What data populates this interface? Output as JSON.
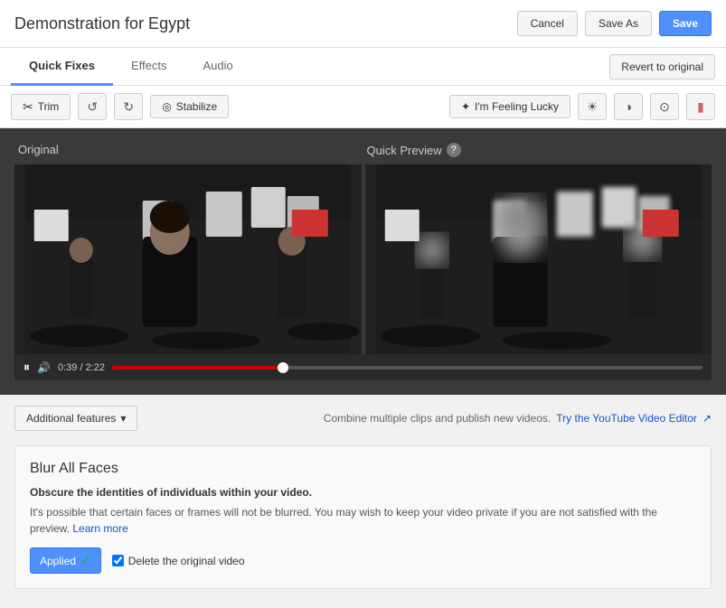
{
  "header": {
    "title": "Demonstration for Egypt",
    "cancel_label": "Cancel",
    "save_as_label": "Save As",
    "save_label": "Save"
  },
  "tabs": {
    "quick_fixes_label": "Quick Fixes",
    "effects_label": "Effects",
    "audio_label": "Audio",
    "revert_label": "Revert to original"
  },
  "toolbar": {
    "trim_label": "Trim",
    "stabilize_label": "Stabilize",
    "feeling_lucky_label": "I'm Feeling Lucky"
  },
  "video": {
    "original_label": "Original",
    "preview_label": "Quick Preview",
    "time_current": "0:39",
    "time_total": "2:22",
    "progress_percent": 29
  },
  "bottom": {
    "additional_features_label": "Additional features",
    "combine_clips_text": "Combine multiple clips and publish new videos.",
    "youtube_editor_label": "Try the YouTube Video Editor"
  },
  "blur_section": {
    "title": "Blur All Faces",
    "subtitle": "Obscure the identities of individuals within your video.",
    "description": "It's possible that certain faces or frames will not be blurred. You may wish to keep your video private if you are not satisfied with the preview.",
    "learn_more_label": "Learn more",
    "applied_label": "Applied",
    "delete_original_label": "Delete the original video"
  }
}
